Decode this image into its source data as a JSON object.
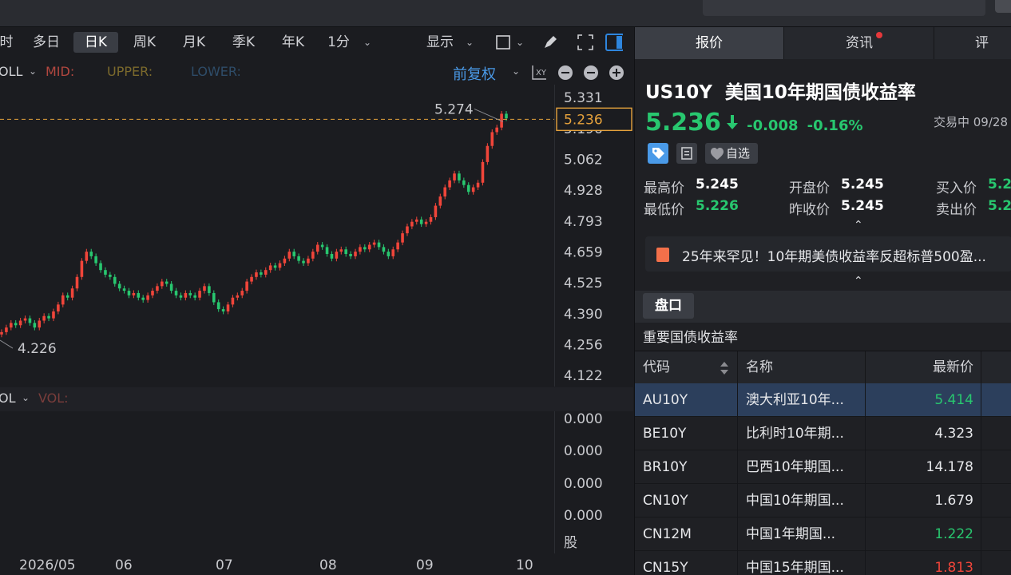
{
  "toolbar": {
    "periods": [
      {
        "label": "时",
        "active": false
      },
      {
        "label": "多日",
        "active": false
      },
      {
        "label": "日K",
        "active": true
      },
      {
        "label": "周K",
        "active": false
      },
      {
        "label": "月K",
        "active": false
      },
      {
        "label": "季K",
        "active": false
      },
      {
        "label": "年K",
        "active": false
      },
      {
        "label": "1分",
        "active": false
      }
    ],
    "display_label": "显示",
    "icons": [
      "rectangle-icon",
      "pen-icon",
      "fullscreen-icon",
      "sidebar-toggle-icon"
    ]
  },
  "indicators": {
    "main": "OLL",
    "mid": "MID:",
    "upper": "UPPER:",
    "lower": "LOWER:",
    "adjust": "前复权",
    "vol_main": "OL",
    "vol_label": "VOL:",
    "colors": {
      "mid": "#b2473f",
      "upper": "#7c6a2c",
      "lower": "#2e4c68"
    }
  },
  "chart_data": {
    "type": "candlestick",
    "x_tick_labels": [
      "2026/05",
      "06",
      "07",
      "08",
      "09",
      "10"
    ],
    "y_tick_labels": [
      "5.331",
      "5.196",
      "5.062",
      "4.928",
      "4.793",
      "4.659",
      "4.525",
      "4.390",
      "4.256",
      "4.122"
    ],
    "ylim": [
      4.122,
      5.331
    ],
    "current_price_label": "5.236",
    "high_annotation": "5.274",
    "low_annotation": "4.226",
    "volume_axis_labels": [
      "0.000",
      "0.000",
      "0.000",
      "0.000"
    ],
    "volume_unit": "股",
    "up_color": "#f0453a",
    "down_color": "#28c76f",
    "candles_close_approx": [
      4.31,
      4.33,
      4.35,
      4.34,
      4.36,
      4.37,
      4.35,
      4.33,
      4.36,
      4.38,
      4.37,
      4.4,
      4.43,
      4.47,
      4.46,
      4.5,
      4.55,
      4.62,
      4.66,
      4.64,
      4.61,
      4.58,
      4.56,
      4.55,
      4.52,
      4.5,
      4.49,
      4.47,
      4.48,
      4.46,
      4.45,
      4.47,
      4.49,
      4.51,
      4.53,
      4.52,
      4.49,
      4.47,
      4.46,
      4.48,
      4.47,
      4.46,
      4.49,
      4.51,
      4.48,
      4.44,
      4.41,
      4.4,
      4.43,
      4.46,
      4.47,
      4.49,
      4.53,
      4.55,
      4.57,
      4.56,
      4.58,
      4.6,
      4.59,
      4.61,
      4.63,
      4.66,
      4.64,
      4.62,
      4.61,
      4.63,
      4.66,
      4.69,
      4.68,
      4.65,
      4.63,
      4.66,
      4.67,
      4.65,
      4.64,
      4.66,
      4.68,
      4.67,
      4.69,
      4.7,
      4.68,
      4.66,
      4.64,
      4.67,
      4.7,
      4.74,
      4.77,
      4.79,
      4.8,
      4.78,
      4.79,
      4.81,
      4.86,
      4.9,
      4.94,
      4.97,
      5.0,
      4.97,
      4.95,
      4.92,
      4.94,
      4.96,
      5.05,
      5.12,
      5.18,
      5.2,
      5.26,
      5.24
    ]
  },
  "panel": {
    "tabs": [
      {
        "label": "报价",
        "active": true
      },
      {
        "label": "资讯",
        "active": false,
        "badge": true
      },
      {
        "label": "评",
        "active": false
      }
    ],
    "symbol": "US10Y",
    "name": "美国10年期国债收益率",
    "price": "5.236",
    "change": "-0.008",
    "change_pct": "-0.16%",
    "status": "交易中 09/28",
    "watch_label": "自选",
    "quote": {
      "high_label": "最高价",
      "high": "5.245",
      "open_label": "开盘价",
      "open": "5.245",
      "bid_label": "买入价",
      "bid": "5.2",
      "low_label": "最低价",
      "low": "5.226",
      "prev_label": "昨收价",
      "prev": "5.245",
      "ask_label": "卖出价",
      "ask": "5.2"
    },
    "news": "25年来罕见！10年期美债收益率反超标普500盈...",
    "pankou": "盘口",
    "bond_title": "重要国债收益率",
    "table": {
      "headers": {
        "code": "代码",
        "name": "名称",
        "price": "最新价"
      },
      "rows": [
        {
          "code": "AU10Y",
          "name": "澳大利亚10年...",
          "price": "5.414",
          "color": "green",
          "selected": true
        },
        {
          "code": "BE10Y",
          "name": "比利时10年期...",
          "price": "4.323",
          "color": "white",
          "selected": false
        },
        {
          "code": "BR10Y",
          "name": "巴西10年期国...",
          "price": "14.178",
          "color": "white",
          "selected": false
        },
        {
          "code": "CN10Y",
          "name": "中国10年期国...",
          "price": "1.679",
          "color": "white",
          "selected": false
        },
        {
          "code": "CN12M",
          "name": "中国1年期国...",
          "price": "1.222",
          "color": "green",
          "selected": false
        },
        {
          "code": "CN15Y",
          "name": "中国15年期国...",
          "price": "1.813",
          "color": "red",
          "selected": false
        }
      ]
    }
  }
}
